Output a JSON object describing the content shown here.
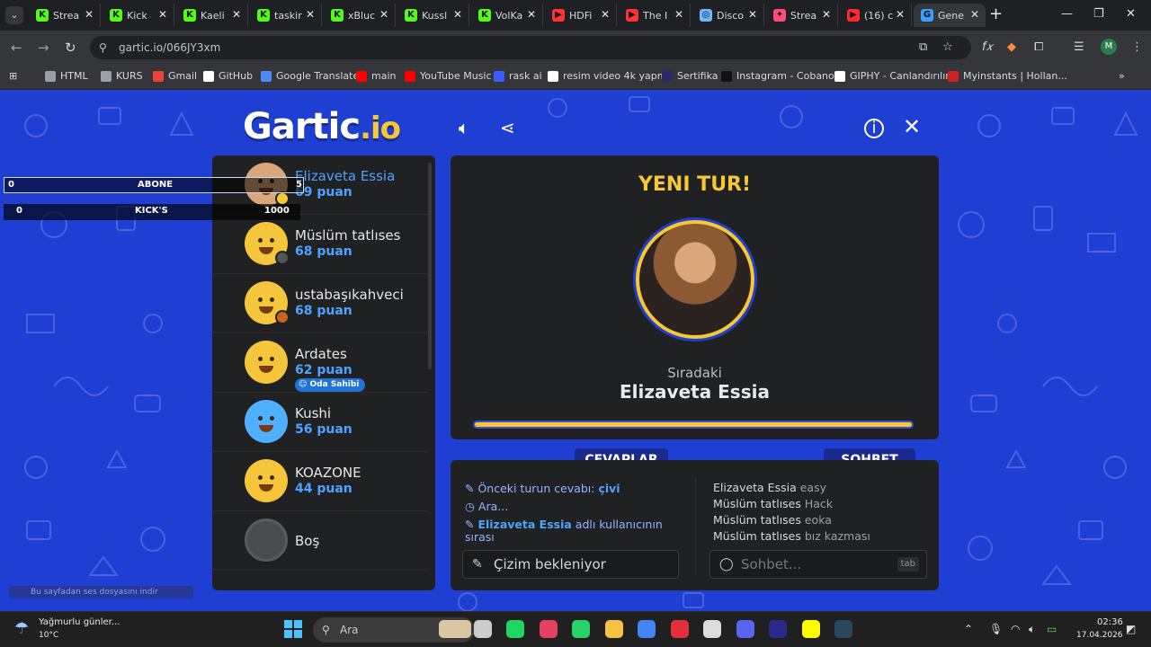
{
  "browser": {
    "tabs": [
      {
        "title": "Strea",
        "fav": "K",
        "color": "#53fc18"
      },
      {
        "title": "Kick",
        "fav": "K",
        "color": "#53fc18"
      },
      {
        "title": "Kaeli",
        "fav": "K",
        "color": "#53fc18"
      },
      {
        "title": "taskir",
        "fav": "K",
        "color": "#53fc18"
      },
      {
        "title": "xBluc",
        "fav": "K",
        "color": "#53fc18"
      },
      {
        "title": "Kussl",
        "fav": "K",
        "color": "#53fc18"
      },
      {
        "title": "VolKa",
        "fav": "K",
        "color": "#53fc18"
      },
      {
        "title": "HDFi",
        "fav": "▶",
        "color": "#ff3333"
      },
      {
        "title": "The I",
        "fav": "▶",
        "color": "#ff3333"
      },
      {
        "title": "Disco",
        "fav": "◎",
        "color": "#6fb6ff"
      },
      {
        "title": "Strea",
        "fav": "✦",
        "color": "#ff4d7a"
      },
      {
        "title": "(16) c",
        "fav": "▶",
        "color": "#ff2a2a"
      },
      {
        "title": "Gene",
        "fav": "G",
        "color": "#3aa0ff"
      }
    ],
    "new_tab_label": "+",
    "url": "gartic.io/066JY3xm",
    "profile_initial": "M",
    "bookmarks": [
      {
        "label": "HTML",
        "color": "#9aa0a6"
      },
      {
        "label": "KURS",
        "color": "#9aa0a6"
      },
      {
        "label": "Gmail",
        "color": "#ea4335"
      },
      {
        "label": "GitHub",
        "color": "#ffffff"
      },
      {
        "label": "Google Translate",
        "color": "#4a8af4"
      },
      {
        "label": "main",
        "color": "#ff0000"
      },
      {
        "label": "YouTube Music",
        "color": "#ff0000"
      },
      {
        "label": "rask ai",
        "color": "#3b5bff"
      },
      {
        "label": "resim video 4k yapma",
        "color": "#ffffff"
      },
      {
        "label": "Sertifika",
        "color": "#2a2a6a"
      },
      {
        "label": "Instagram - Cobanov",
        "color": "#111111"
      },
      {
        "label": "GIPHY - Canlandırılın",
        "color": "#ffffff"
      },
      {
        "label": "Myinstants | Hollan...",
        "color": "#cc2222"
      }
    ]
  },
  "game": {
    "logo_main": "Gartic",
    "logo_suffix": ".io",
    "overlay": {
      "abone_left": "0",
      "abone_label": "ABONE",
      "abone_right": "5",
      "kicks_left": "0",
      "kicks_label": "KICK'S",
      "kicks_right": "1000"
    },
    "players": [
      {
        "name": "Elizaveta Essia",
        "score": "69 puan",
        "color": "#d9a77a",
        "dot": "#f7c833"
      },
      {
        "name": "Müslüm tatlıses",
        "score": "68 puan",
        "color": "#f5c63b",
        "dot": "#555555"
      },
      {
        "name": "ustabaşıkahveci",
        "score": "68 puan",
        "color": "#f5c63b",
        "dot": "#c8641a"
      },
      {
        "name": "Ardates",
        "score": "62 puan",
        "color": "#f5c63b",
        "dot": ""
      },
      {
        "name": "Kushi",
        "score": "56 puan",
        "color": "#4fb0ff",
        "dot": ""
      },
      {
        "name": "KOAZONE",
        "score": "44 puan",
        "color": "#f5c63b",
        "dot": ""
      },
      {
        "name": "Boş",
        "score": "",
        "color": "#4a4b4e",
        "dot": ""
      }
    ],
    "owner_badge": "Oda Sahibi",
    "stage": {
      "round_title": "YENI TUR!",
      "next_label": "Sıradaki",
      "next_name": "Elizaveta Essia",
      "timer_fraction": 1.0
    },
    "answers_tab": "CEVAPLAR",
    "chat_tab": "SOHBET",
    "answers": {
      "prev_prefix": "Önceki turun cevabı: ",
      "prev_word": "çivi",
      "searching": "Ara...",
      "turn_name": "Elizaveta Essia",
      "turn_suffix": " adlı kullanıcının",
      "turn_line2": "sırası"
    },
    "chat": [
      {
        "user": "Elizaveta Essia",
        "msg": " easy"
      },
      {
        "user": "Müslüm tatlıses",
        "msg": " Hack"
      },
      {
        "user": "Müslüm tatlıses",
        "msg": " eoka"
      },
      {
        "user": "Müslüm tatlıses",
        "msg": " bız kazması"
      }
    ],
    "draw_input": "Çizim bekleniyor",
    "chat_placeholder": "Sohbet...",
    "chat_tab_key": "tab",
    "download_bar": "Bu sayfadan ses dosyasını indir"
  },
  "taskbar": {
    "weather_title": "Yağmurlu günler...",
    "weather_temp": "10°C",
    "search_label": "Ara",
    "time": "02:36",
    "date": "17.04.2026",
    "apps": [
      "#d8c7a0",
      "#cccccc",
      "#1ed760",
      "#e4405f",
      "#25d366",
      "#f5c242",
      "#4285f4",
      "#e0303a",
      "#dddddd",
      "#5865f2",
      "#2a2a8a",
      "#fffc00",
      "#2a475e"
    ]
  }
}
